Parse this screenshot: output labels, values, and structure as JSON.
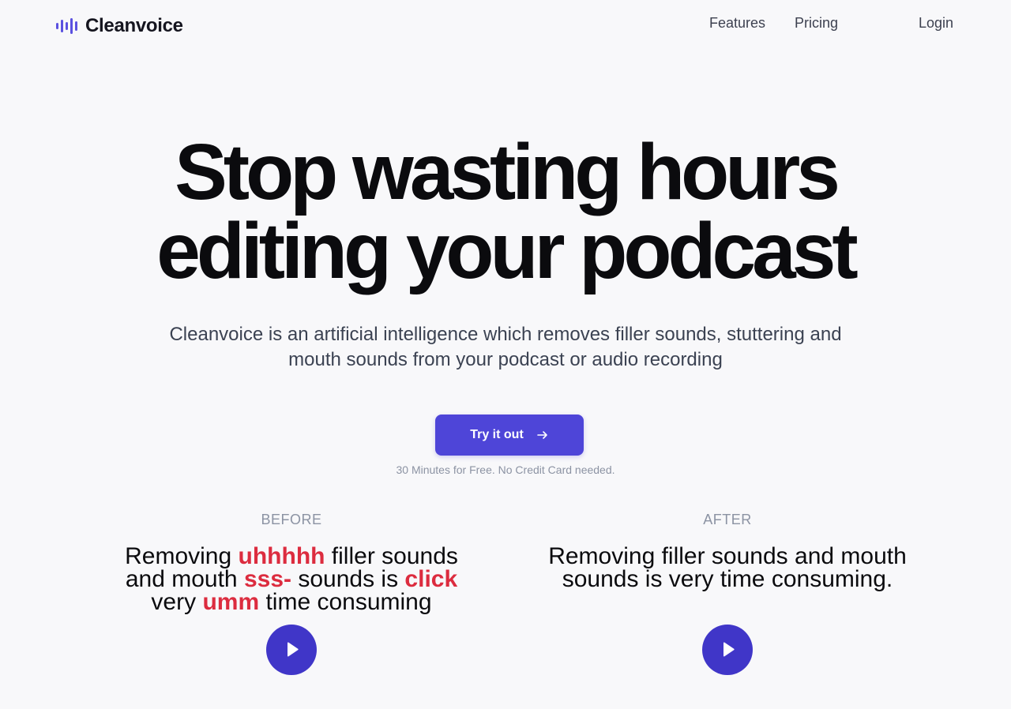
{
  "header": {
    "logo_text": "Cleanvoice",
    "nav": {
      "features": "Features",
      "pricing": "Pricing",
      "login": "Login"
    }
  },
  "hero": {
    "title_line1": "Stop wasting hours",
    "title_line2": "editing your podcast",
    "subtitle": "Cleanvoice is an artificial intelligence which removes filler sounds, stuttering and mouth sounds from your podcast or audio recording",
    "cta_label": "Try it out",
    "cta_note": "30 Minutes for Free. No Credit Card needed."
  },
  "before": {
    "label": "BEFORE",
    "t1": "Removing ",
    "f1": "uhhhhh",
    "t2": " filler sounds and mouth ",
    "f2": "sss-",
    "t3": " sounds is ",
    "f3": "click",
    "t4": " very ",
    "f4": "umm",
    "t5": " time consuming"
  },
  "after": {
    "label": "AFTER",
    "text": "Removing filler sounds and mouth sounds is very time consuming."
  },
  "colors": {
    "accent": "#4e45d8",
    "play": "#4036c8",
    "filler": "#dc2c3f",
    "background": "#f8f8fa"
  },
  "icons": {
    "logo": "waveform-icon",
    "cta": "arrow-right-icon",
    "play": "play-icon"
  }
}
